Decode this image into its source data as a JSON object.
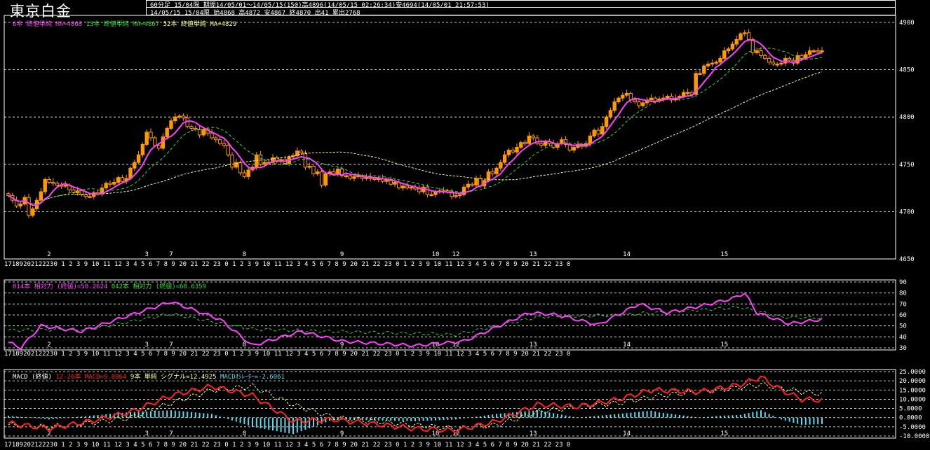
{
  "header": {
    "title": "東京白金",
    "line1": "60分足 15/04限 期間14/05/01～14/05/15(150)高4896(14/05/15 02:26:34)安4694(14/05/01 21:57:53)",
    "line2": "14/05/15 15/04限 始4868 高4872 安4867 終4870 出41 累出2768"
  },
  "legends": {
    "price": [
      {
        "text": "6本 終値単純 MA=4868",
        "color": "#ff40ff"
      },
      {
        "text": "13本 終値単純 MA=4867",
        "color": "#33dd33"
      },
      {
        "text": "52本 終値単純 MA=4829",
        "color": "#ffff88"
      }
    ],
    "rsi": [
      {
        "text": "014本 相対力 (終値)=58.2624",
        "color": "#ff40ff"
      },
      {
        "text": "042本 相対力 (終値)=60.6359",
        "color": "#33dd33"
      }
    ],
    "macd": [
      {
        "text": "MACD (終値)",
        "color": "#ffffff"
      },
      {
        "text": "12-26本 MACD=9.8864",
        "color": "#ff2222"
      },
      {
        "text": "9本 単純 シグナル=12.4925",
        "color": "#ffff88"
      },
      {
        "text": "MACDｵｼﾚｰﾀｰ=-2.6061",
        "color": "#55ddee"
      }
    ]
  },
  "colors": {
    "candle": "#ff9900",
    "ma6": "#ff40ff",
    "ma13": "#33dd33",
    "ma52": "#ffff88",
    "rsi14": "#ff40ff",
    "rsi42": "#33dd33",
    "macd": "#ff2222",
    "signal": "#ffff88",
    "osc": "#55ddee"
  },
  "chart_data": [
    {
      "type": "candlestick",
      "name": "price",
      "ylim": [
        4650,
        4900
      ],
      "yticks": [
        4650,
        4700,
        4750,
        4800,
        4850,
        4900
      ],
      "day_labels": [
        {
          "i": 10,
          "t": "2"
        },
        {
          "i": 34,
          "t": "3"
        },
        {
          "i": 40,
          "t": "7"
        },
        {
          "i": 58,
          "t": "8"
        },
        {
          "i": 82,
          "t": "9"
        },
        {
          "i": 105,
          "t": "10"
        },
        {
          "i": 110,
          "t": "12"
        },
        {
          "i": 129,
          "t": "13"
        },
        {
          "i": 152,
          "t": "14"
        },
        {
          "i": 176,
          "t": "15"
        }
      ],
      "hour_label_row": "17189202122230 1 2 3 9 10 11 12 3 4 5 6 7 8 9 20 21 22 23 0 1 2 3 9 10 11 12 3 4 5 6 7 8 9 20 21 22 23 0 1 2 3 9 10 11 12 3 4 5 6 7 8 9 20 21 22 23 0",
      "close": [
        4717,
        4712,
        4706,
        4708,
        4715,
        4696,
        4703,
        4712,
        4721,
        4734,
        4731,
        4730,
        4728,
        4727,
        4728,
        4723,
        4720,
        4722,
        4718,
        4716,
        4716,
        4720,
        4719,
        4725,
        4730,
        4729,
        4731,
        4736,
        4732,
        4735,
        4746,
        4752,
        4760,
        4771,
        4784,
        4778,
        4770,
        4767,
        4779,
        4788,
        4796,
        4800,
        4801,
        4799,
        4790,
        4788,
        4787,
        4781,
        4787,
        4783,
        4778,
        4776,
        4772,
        4770,
        4760,
        4747,
        4752,
        4741,
        4737,
        4744,
        4747,
        4760,
        4750,
        4752,
        4752,
        4757,
        4753,
        4755,
        4751,
        4758,
        4759,
        4764,
        4762,
        4747,
        4748,
        4740,
        4742,
        4728,
        4740,
        4742,
        4740,
        4745,
        4738,
        4738,
        4735,
        4737,
        4738,
        4735,
        4737,
        4735,
        4734,
        4735,
        4732,
        4734,
        4729,
        4731,
        4725,
        4727,
        4725,
        4726,
        4724,
        4721,
        4726,
        4718,
        4718,
        4721,
        4722,
        4722,
        4721,
        4716,
        4717,
        4718,
        4726,
        4729,
        4728,
        4735,
        4727,
        4733,
        4742,
        4740,
        4746,
        4752,
        4760,
        4765,
        4763,
        4768,
        4773,
        4772,
        4780,
        4778,
        4772,
        4770,
        4774,
        4772,
        4768,
        4772,
        4776,
        4771,
        4765,
        4768,
        4771,
        4769,
        4772,
        4780,
        4786,
        4782,
        4790,
        4800,
        4807,
        4816,
        4820,
        4823,
        4825,
        4818,
        4816,
        4812,
        4815,
        4818,
        4820,
        4817,
        4819,
        4820,
        4822,
        4818,
        4820,
        4822,
        4826,
        4826,
        4824,
        4846,
        4846,
        4854,
        4856,
        4857,
        4858,
        4862,
        4870,
        4872,
        4877,
        4882,
        4888,
        4889,
        4882,
        4868,
        4870,
        4865,
        4862,
        4858,
        4856,
        4856,
        4857,
        4862,
        4860,
        4857,
        4865,
        4862,
        4866,
        4870,
        4870,
        4869,
        4870
      ]
    },
    {
      "type": "line",
      "name": "rsi",
      "ylim": [
        30,
        90
      ],
      "yticks": [
        30,
        40,
        50,
        60,
        70,
        80,
        90
      ],
      "rsi14_anchors": [
        [
          0,
          35
        ],
        [
          3,
          30
        ],
        [
          8,
          50
        ],
        [
          18,
          45
        ],
        [
          26,
          55
        ],
        [
          40,
          72
        ],
        [
          52,
          56
        ],
        [
          60,
          32
        ],
        [
          72,
          45
        ],
        [
          82,
          36
        ],
        [
          100,
          32
        ],
        [
          112,
          36
        ],
        [
          128,
          62
        ],
        [
          135,
          60
        ],
        [
          145,
          51
        ],
        [
          155,
          70
        ],
        [
          162,
          62
        ],
        [
          170,
          68
        ],
        [
          178,
          75
        ],
        [
          181,
          80
        ],
        [
          184,
          62
        ],
        [
          192,
          52
        ],
        [
          200,
          56
        ],
        [
          205,
          56
        ]
      ],
      "rsi42_anchors": [
        [
          0,
          46
        ],
        [
          20,
          47
        ],
        [
          40,
          61
        ],
        [
          60,
          47
        ],
        [
          90,
          44
        ],
        [
          110,
          42
        ],
        [
          130,
          58
        ],
        [
          150,
          60
        ],
        [
          180,
          67
        ],
        [
          190,
          58
        ],
        [
          205,
          57
        ]
      ]
    },
    {
      "type": "line",
      "name": "macd",
      "ylim": [
        -10,
        25
      ],
      "yticks": [
        -10,
        -5,
        0,
        5,
        10,
        15,
        20,
        25
      ],
      "ytick_labels": [
        "-10.0000",
        "-5.0000",
        "0.0000",
        "5.0000",
        "10.0000",
        "15.0000",
        "20.0000",
        "25.0000"
      ],
      "macd_anchors": [
        [
          0,
          -3
        ],
        [
          10,
          -6
        ],
        [
          20,
          -2
        ],
        [
          30,
          3
        ],
        [
          40,
          12
        ],
        [
          50,
          17
        ],
        [
          60,
          12
        ],
        [
          70,
          -2
        ],
        [
          80,
          -1
        ],
        [
          100,
          -6
        ],
        [
          110,
          -7
        ],
        [
          120,
          -2
        ],
        [
          130,
          7
        ],
        [
          140,
          6
        ],
        [
          150,
          10
        ],
        [
          158,
          15
        ],
        [
          170,
          14
        ],
        [
          180,
          18
        ],
        [
          185,
          22
        ],
        [
          190,
          15
        ],
        [
          195,
          10
        ],
        [
          205,
          9
        ]
      ],
      "signal_anchors": [
        [
          0,
          -4
        ],
        [
          10,
          -5
        ],
        [
          20,
          -3
        ],
        [
          30,
          0
        ],
        [
          40,
          8
        ],
        [
          50,
          15
        ],
        [
          60,
          17
        ],
        [
          70,
          7
        ],
        [
          80,
          0
        ],
        [
          100,
          -4
        ],
        [
          110,
          -6
        ],
        [
          120,
          -4
        ],
        [
          130,
          3
        ],
        [
          140,
          6
        ],
        [
          150,
          8
        ],
        [
          160,
          12
        ],
        [
          175,
          15
        ],
        [
          185,
          18
        ],
        [
          195,
          14
        ],
        [
          205,
          12
        ]
      ]
    }
  ]
}
